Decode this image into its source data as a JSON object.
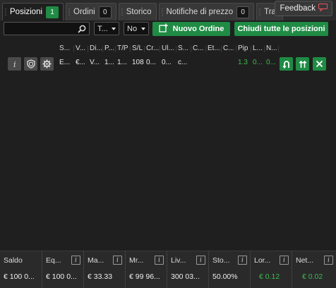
{
  "tabs": [
    {
      "label": "Posizioni",
      "count": "1"
    },
    {
      "label": "Ordini",
      "count": "0"
    },
    {
      "label": "Storico"
    },
    {
      "label": "Notifiche di prezzo",
      "count": "0"
    },
    {
      "label": "Tra"
    }
  ],
  "feedback": {
    "label": "Feedback"
  },
  "toolbar": {
    "search_value": "",
    "filter_select": "T...",
    "no_select": "No",
    "new_order": "Nuovo Ordine",
    "close_all": "Chiudi tutte le posizioni"
  },
  "grid": {
    "headers": [
      "S...",
      "V...",
      "Di...",
      "P...",
      "T/P",
      "S/L",
      "Cr...",
      "Ul...",
      "S...",
      "C...",
      "Et...",
      "C...",
      "Pip",
      "L...",
      "N..."
    ],
    "row": [
      "E...",
      "€...",
      "V...",
      "1...",
      "1...",
      "108",
      "0...",
      "0...",
      "c...",
      "",
      "",
      "",
      "1.3",
      "0...",
      "0..."
    ]
  },
  "footer": [
    {
      "label": "Saldo",
      "value": "€ 100 0..."
    },
    {
      "label": "Eq...",
      "value": "€ 100 0..."
    },
    {
      "label": "Ma...",
      "value": "€ 33.33"
    },
    {
      "label": "Mr...",
      "value": "€ 99 96..."
    },
    {
      "label": "Liv...",
      "value": "300 03..."
    },
    {
      "label": "Sto...",
      "value": "50.00%"
    },
    {
      "label": "Lor...",
      "value": "€ 0.12"
    },
    {
      "label": "Net...",
      "value": "€ 0.02"
    }
  ],
  "colors": {
    "accent": "#1f8b44",
    "profit": "#3fb950"
  }
}
